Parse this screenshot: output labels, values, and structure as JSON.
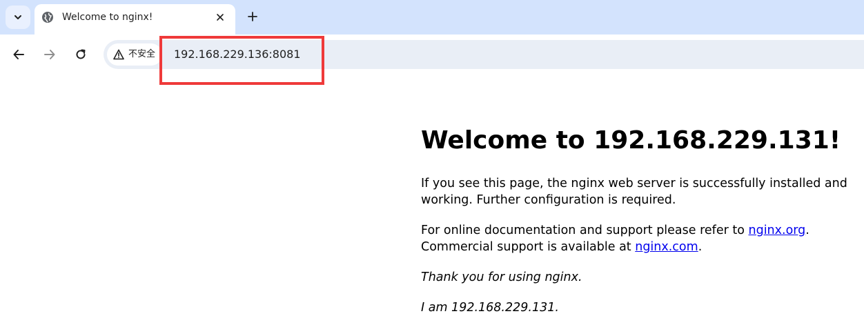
{
  "tab": {
    "title": "Welcome to nginx!",
    "favicon": "globe-icon"
  },
  "omnibox": {
    "security_label": "不安全",
    "url": "192.168.229.136:8081"
  },
  "page": {
    "heading": "Welcome to 192.168.229.131!",
    "para1_line1": "If you see this page, the nginx web server is successfully installed and",
    "para1_line2": "working. Further configuration is required.",
    "para2_line1_prefix": "For online documentation and support please refer to ",
    "para2_link1": "nginx.org",
    "para2_line1_suffix": ".",
    "para2_line2_prefix": "Commercial support is available at ",
    "para2_link2": "nginx.com",
    "para2_line2_suffix": ".",
    "thanks": "Thank you for using nginx.",
    "signature": "I am 192.168.229.131."
  },
  "colors": {
    "tabstrip": "#d3e3fd",
    "omnibox": "#e9eef6",
    "highlight": "#ef3a3a",
    "link": "#0000ee"
  }
}
